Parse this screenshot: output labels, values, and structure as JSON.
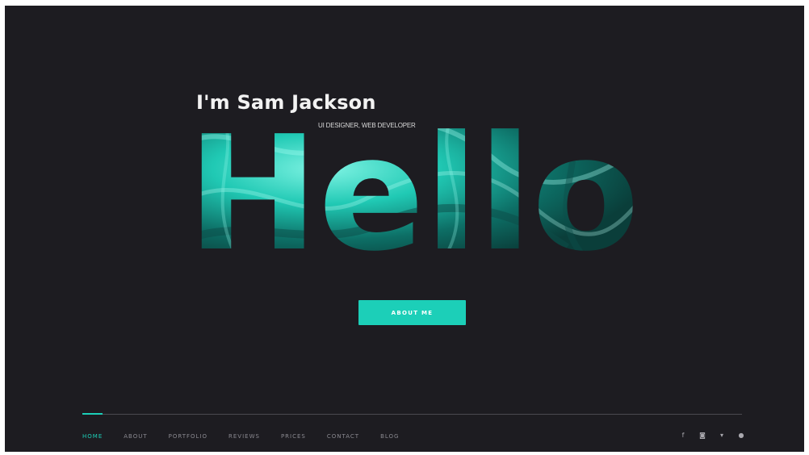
{
  "hero": {
    "intro": "I'm Sam Jackson",
    "role": "UI DESIGNER, WEB DEVELOPER",
    "big_word": "Hello",
    "cta_label": "ABOUT ME"
  },
  "nav": {
    "items": [
      {
        "label": "HOME",
        "active": true
      },
      {
        "label": "ABOUT",
        "active": false
      },
      {
        "label": "PORTFOLIO",
        "active": false
      },
      {
        "label": "REVIEWS",
        "active": false
      },
      {
        "label": "PRICES",
        "active": false
      },
      {
        "label": "CONTACT",
        "active": false
      },
      {
        "label": "BLOG",
        "active": false
      }
    ],
    "progress": 0.03
  },
  "social": {
    "icons": [
      {
        "name": "facebook-icon",
        "glyph": "f"
      },
      {
        "name": "instagram-icon",
        "glyph": "◙"
      },
      {
        "name": "twitter-icon",
        "glyph": "▾"
      },
      {
        "name": "dribbble-icon",
        "glyph": "●"
      }
    ]
  },
  "colors": {
    "background": "#1d1c21",
    "accent": "#1ccfb8",
    "text": "#f2f2f2",
    "muted": "#8a8990"
  }
}
